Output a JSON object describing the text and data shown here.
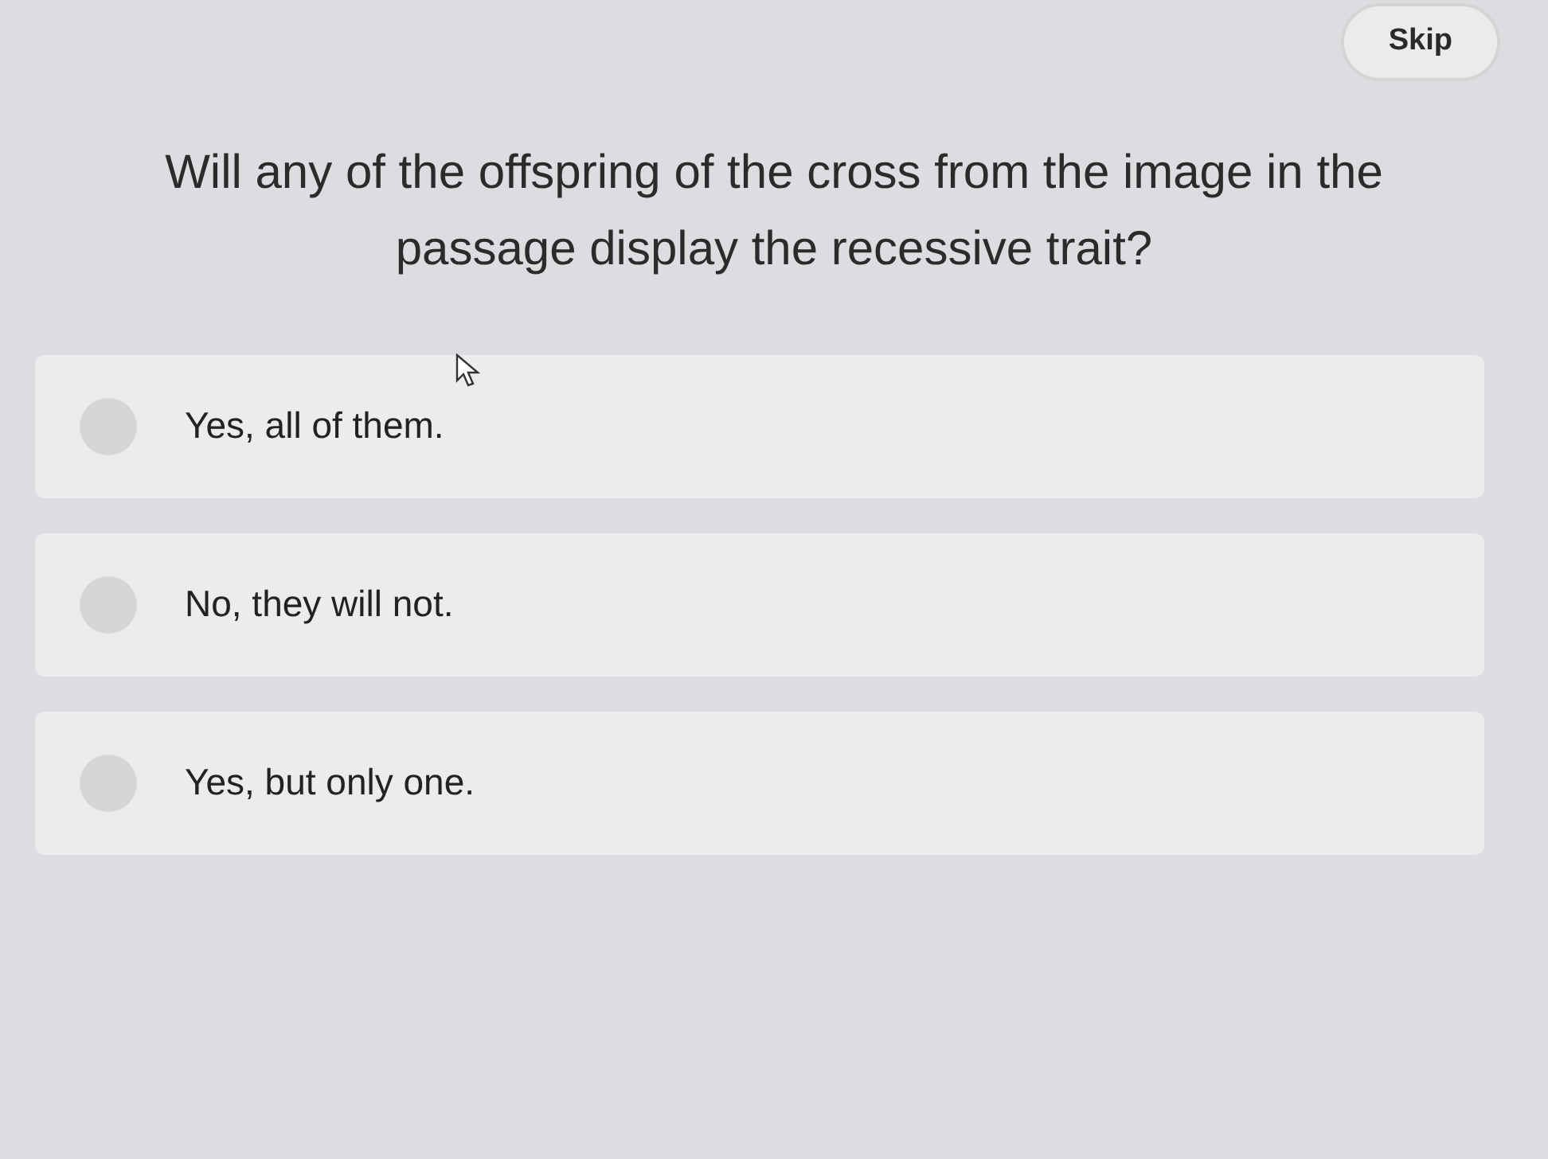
{
  "skip_button": {
    "label": "Skip"
  },
  "question": "Will any of the offspring of the cross from the image in the passage display the recessive trait?",
  "options": [
    {
      "label": "Yes, all of them.",
      "selected": false
    },
    {
      "label": "No, they will not.",
      "selected": false
    },
    {
      "label": "Yes, but only one.",
      "selected": false
    }
  ]
}
